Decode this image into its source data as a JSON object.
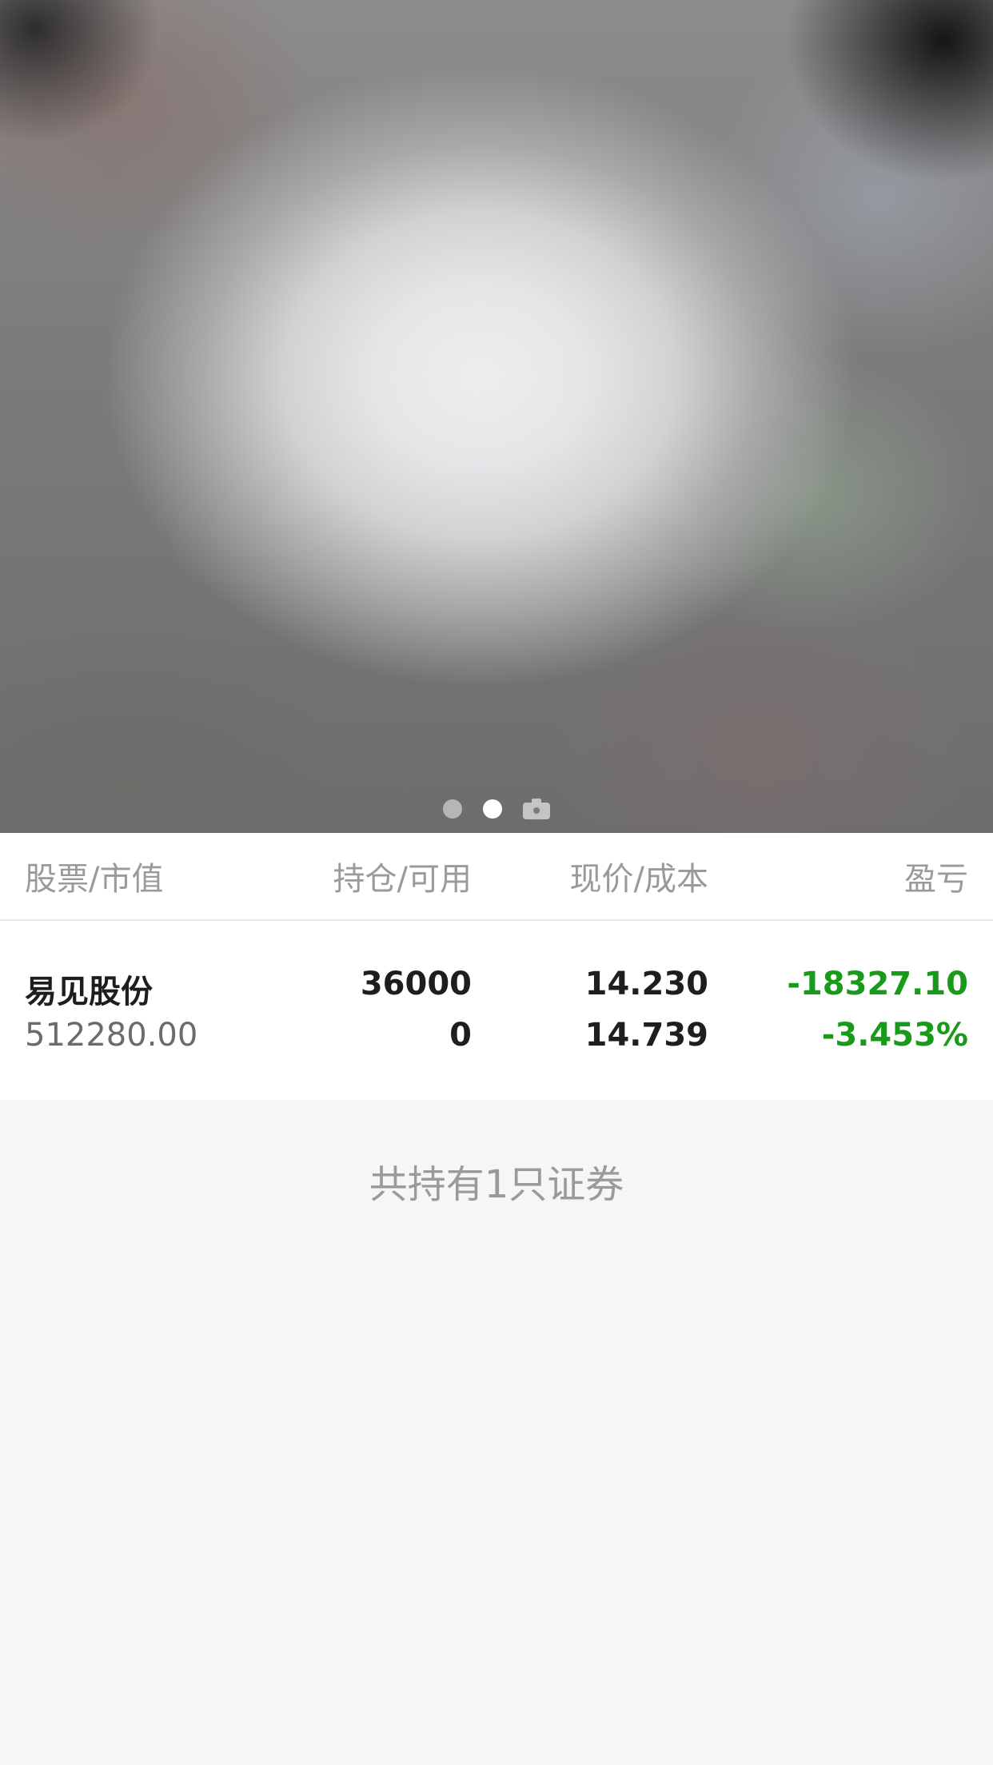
{
  "banner": {
    "pager_dots": 2,
    "active_dot": 1,
    "camera_icon": "camera-icon"
  },
  "table_header": {
    "col1": "股票/市值",
    "col2": "持仓/可用",
    "col3": "现价/成本",
    "col4": "盈亏"
  },
  "holdings": [
    {
      "name": "易见股份",
      "market_value": "512280.00",
      "position": "36000",
      "available": "0",
      "current_price": "14.230",
      "cost": "14.739",
      "pnl": "-18327.10",
      "pnl_pct": "-3.453%"
    }
  ],
  "summary": "共持有1只证券",
  "colors": {
    "loss_green": "#1a9a1a",
    "header_text": "#9a9a9c",
    "background": "#f5f6f8"
  }
}
